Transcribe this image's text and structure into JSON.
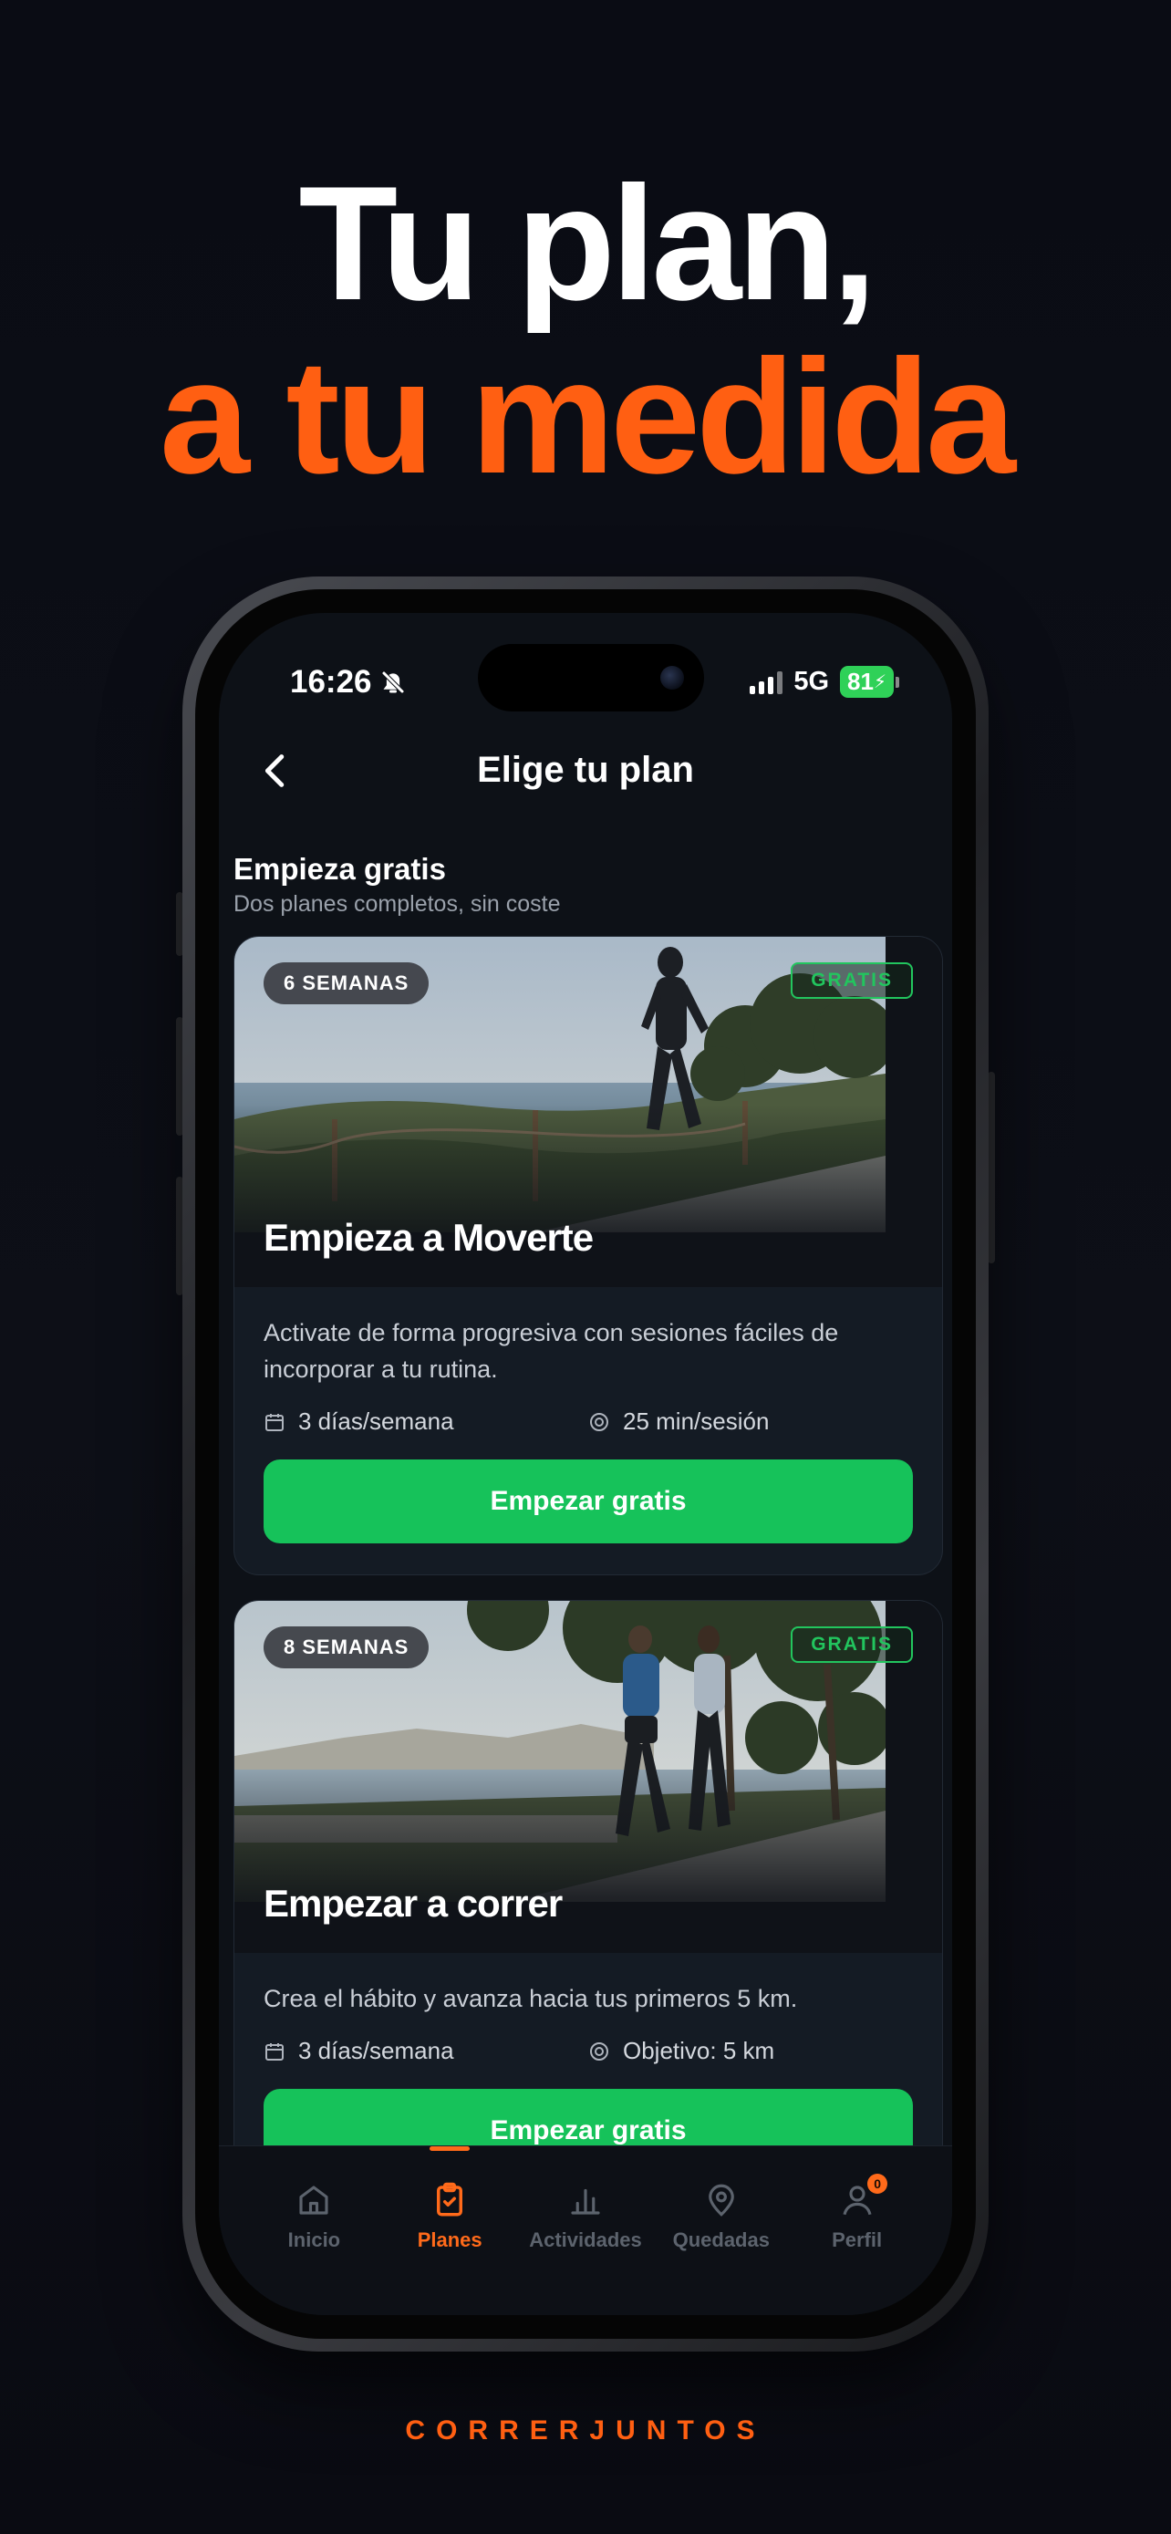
{
  "headline": {
    "line1": "Tu plan,",
    "line2": "a tu medida"
  },
  "status_bar": {
    "time": "16:26",
    "network": "5G",
    "battery": "81"
  },
  "nav": {
    "title": "Elige tu plan"
  },
  "section": {
    "title": "Empieza gratis",
    "subtitle": "Dos planes completos, sin coste"
  },
  "plans": [
    {
      "weeks": "6 SEMANAS",
      "badge": "GRATIS",
      "title": "Empieza a Moverte",
      "description": "Activate de forma progresiva con sesiones fáciles de incorporar a tu rutina.",
      "meta1": "3 días/semana",
      "meta2": "25 min/sesión",
      "cta": "Empezar gratis"
    },
    {
      "weeks": "8 SEMANAS",
      "badge": "GRATIS",
      "title": "Empezar a correr",
      "description": "Crea el hábito y avanza hacia tus primeros 5 km.",
      "meta1": "3 días/semana",
      "meta2": "Objetivo: 5 km",
      "cta": "Empezar gratis"
    }
  ],
  "tabs": [
    {
      "label": "Inicio",
      "icon": "home-icon"
    },
    {
      "label": "Planes",
      "icon": "clipboard-check-icon",
      "active": true
    },
    {
      "label": "Actividades",
      "icon": "bar-chart-icon"
    },
    {
      "label": "Quedadas",
      "icon": "map-pin-icon"
    },
    {
      "label": "Perfil",
      "icon": "user-icon",
      "badge": "0"
    }
  ],
  "brand": "CORRERJUNTOS",
  "colors": {
    "accent": "#ff5f12",
    "cta": "#16c25a",
    "gratis": "#22c55e",
    "background": "#0b0d14"
  }
}
